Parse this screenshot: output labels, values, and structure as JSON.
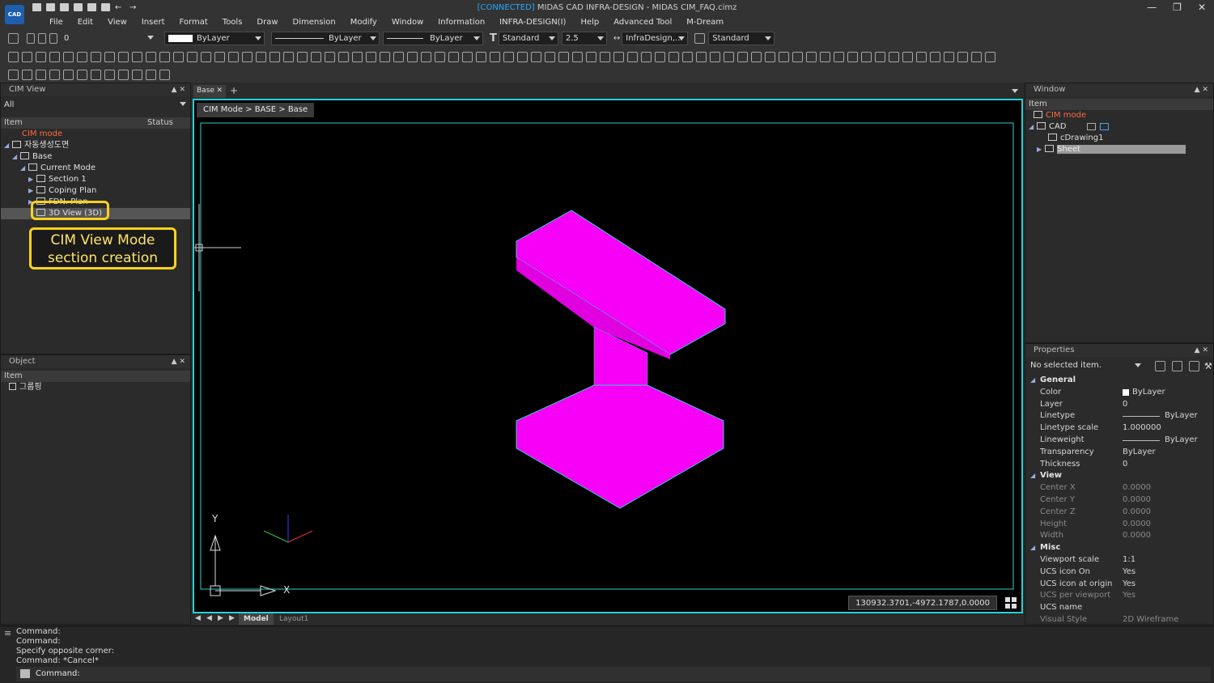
{
  "app": {
    "connected": "[CONNECTED]",
    "title": "MIDAS CAD INFRA-DESIGN - MIDAS CIM_FAQ.cimz",
    "logo": "CAD"
  },
  "menu": [
    "File",
    "Edit",
    "View",
    "Insert",
    "Format",
    "Tools",
    "Draw",
    "Dimension",
    "Modify",
    "Window",
    "Information",
    "INFRA-DESIGN(I)",
    "Help",
    "Advanced Tool",
    "M-Dream"
  ],
  "toolbar": {
    "layer_value": "0",
    "color_value": "ByLayer",
    "linetype_value": "ByLayer",
    "lineweight_value": "ByLayer",
    "textstyle_value": "Standard",
    "textsize_value": "2.5",
    "dimstyle_value": "InfraDesign,...",
    "tablestyle_value": "Standard"
  },
  "cim_view": {
    "title": "CIM View",
    "filter": "All",
    "col_item": "Item",
    "col_status": "Status",
    "rows": [
      {
        "label": "CIM mode"
      },
      {
        "label": "자동생성도면"
      },
      {
        "label": "Base"
      },
      {
        "label": "Current Mode"
      },
      {
        "label": "Section 1"
      },
      {
        "label": "Coping Plan"
      },
      {
        "label": "FDN. Plan"
      },
      {
        "label": "3D View (3D)"
      }
    ]
  },
  "callout": {
    "line1": "CIM View Mode",
    "line2": "section creation"
  },
  "object_panel": {
    "title": "Object",
    "col_item": "Item",
    "row": "그룹핑"
  },
  "doc": {
    "tab_label": "Base",
    "breadcrumb": "CIM Mode > BASE > Base",
    "coords": "130932.3701,-4972.1787,0.0000",
    "axis_y": "Y",
    "axis_x": "X"
  },
  "layout_tabs": [
    "Model",
    "Layout1"
  ],
  "window_panel": {
    "title": "Window",
    "col_item": "Item",
    "rows": [
      "CIM mode",
      "CAD",
      "cDrawing1",
      "Sheet"
    ]
  },
  "properties": {
    "title": "Properties",
    "selection": "No selected item.",
    "sections": [
      {
        "name": "General",
        "rows": [
          {
            "k": "Color",
            "v": "ByLayer"
          },
          {
            "k": "Layer",
            "v": "0"
          },
          {
            "k": "Linetype",
            "v": "ByLayer"
          },
          {
            "k": "Linetype scale",
            "v": "1.000000"
          },
          {
            "k": "Lineweight",
            "v": "ByLayer"
          },
          {
            "k": "Transparency",
            "v": "ByLayer"
          },
          {
            "k": "Thickness",
            "v": "0"
          }
        ]
      },
      {
        "name": "View",
        "rows": [
          {
            "k": "Center X",
            "v": "0.0000"
          },
          {
            "k": "Center Y",
            "v": "0.0000"
          },
          {
            "k": "Center Z",
            "v": "0.0000"
          },
          {
            "k": "Height",
            "v": "0.0000"
          },
          {
            "k": "Width",
            "v": "0.0000"
          }
        ]
      },
      {
        "name": "Misc",
        "rows": [
          {
            "k": "Viewport scale",
            "v": "1:1"
          },
          {
            "k": "UCS icon On",
            "v": "Yes"
          },
          {
            "k": "UCS icon at origin",
            "v": "Yes"
          },
          {
            "k": "UCS per viewport",
            "v": "Yes"
          },
          {
            "k": "UCS name",
            "v": ""
          },
          {
            "k": "Visual Style",
            "v": "2D Wireframe"
          }
        ]
      }
    ]
  },
  "command": {
    "history": [
      "Command:",
      "Command:",
      "Specify opposite corner:",
      "Command: *Cancel*"
    ],
    "prompt": "Command:"
  },
  "colors": {
    "accent": "#2bd0d0",
    "model": "#ff00ff",
    "highlight": "#ffd21a",
    "cim_mode": "#ff6a3d"
  }
}
